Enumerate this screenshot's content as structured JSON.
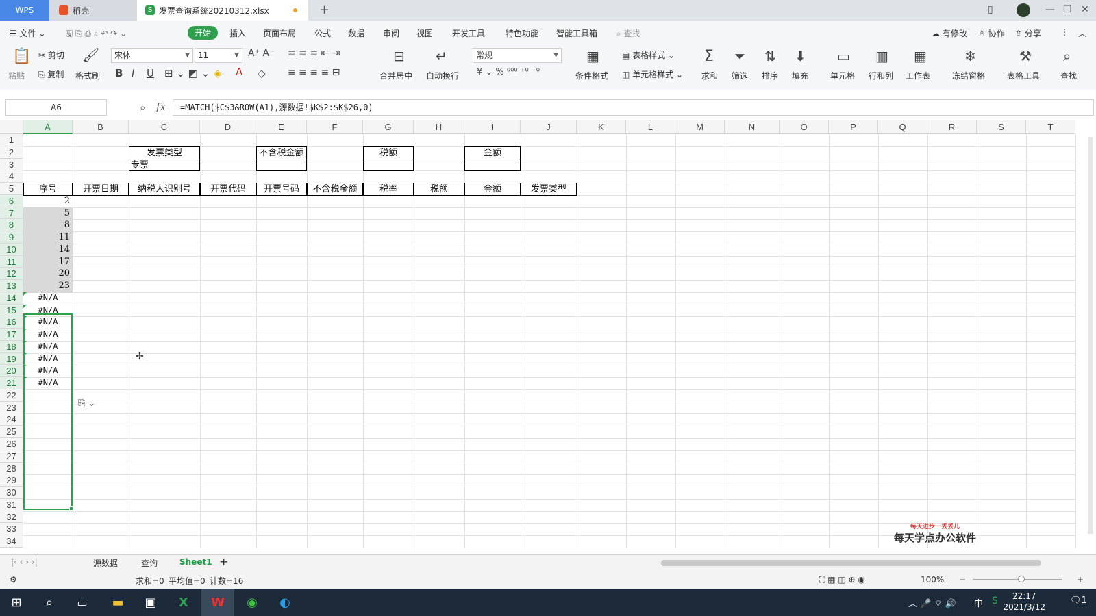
{
  "titlebar": {
    "wps_label": "WPS",
    "tab2_label": "稻壳",
    "file_tab_label": "发票查询系统20210312.xlsx"
  },
  "menubar": {
    "file": "文件",
    "items": [
      "开始",
      "插入",
      "页面布局",
      "公式",
      "数据",
      "审阅",
      "视图",
      "开发工具",
      "特色功能",
      "智能工具箱"
    ],
    "search": "查找",
    "modified": "有修改",
    "collab": "协作",
    "share": "分享"
  },
  "ribbon": {
    "paste": "粘贴",
    "cut": "剪切",
    "copy": "复制",
    "format_painter": "格式刷",
    "font_name": "宋体",
    "font_size": "11",
    "merge_center": "合并居中",
    "wrap_text": "自动换行",
    "number_format": "常规",
    "cond_format": "条件格式",
    "table_style": "表格样式",
    "cell_style": "单元格样式",
    "sum": "求和",
    "filter": "筛选",
    "sort": "排序",
    "fill": "填充",
    "cell": "单元格",
    "row_col": "行和列",
    "worksheet": "工作表",
    "freeze": "冻结窗格",
    "table_tools": "表格工具",
    "find": "查找"
  },
  "formula": {
    "namebox": "A6",
    "fx": "fx",
    "text": "=MATCH($C$3&ROW(A1),源数据!$K$2:$K$26,0)"
  },
  "grid": {
    "columns": [
      "A",
      "B",
      "C",
      "D",
      "E",
      "F",
      "G",
      "H",
      "I",
      "J",
      "K",
      "L",
      "M",
      "N",
      "O",
      "P",
      "Q",
      "R",
      "S",
      "T"
    ],
    "rows": [
      "1",
      "2",
      "3",
      "4",
      "5",
      "6",
      "7",
      "8",
      "9",
      "10",
      "11",
      "12",
      "13",
      "14",
      "15",
      "16",
      "17",
      "18",
      "19",
      "20",
      "21",
      "22",
      "23",
      "24",
      "25",
      "26",
      "27",
      "28",
      "29",
      "30",
      "31",
      "32",
      "33",
      "34"
    ],
    "top_headers": {
      "invoice_type": "发票类型",
      "invoice_type_value": "专票",
      "amount_ex_tax": "不含税金额",
      "tax": "税额",
      "amount": "金额"
    },
    "table_headers": [
      "序号",
      "开票日期",
      "纳税人识别号",
      "开票代码",
      "开票号码",
      "不含税金额",
      "税率",
      "税额",
      "金额",
      "发票类型"
    ],
    "col_a_values": [
      "2",
      "5",
      "8",
      "11",
      "14",
      "17",
      "20",
      "23",
      "#N/A",
      "#N/A",
      "#N/A",
      "#N/A",
      "#N/A",
      "#N/A",
      "#N/A",
      "#N/A"
    ]
  },
  "sheets": [
    "源数据",
    "查询",
    "Sheet1"
  ],
  "status": {
    "sum": "求和=0",
    "avg": "平均值=0",
    "count": "计数=16",
    "zoom": "100%"
  },
  "watermark": {
    "small": "每天进步一丢丢儿",
    "big": "每天学点办公软件"
  },
  "taskbar": {
    "time": "22:17",
    "date": "2021/3/12",
    "ime": "中",
    "notif": "1"
  }
}
